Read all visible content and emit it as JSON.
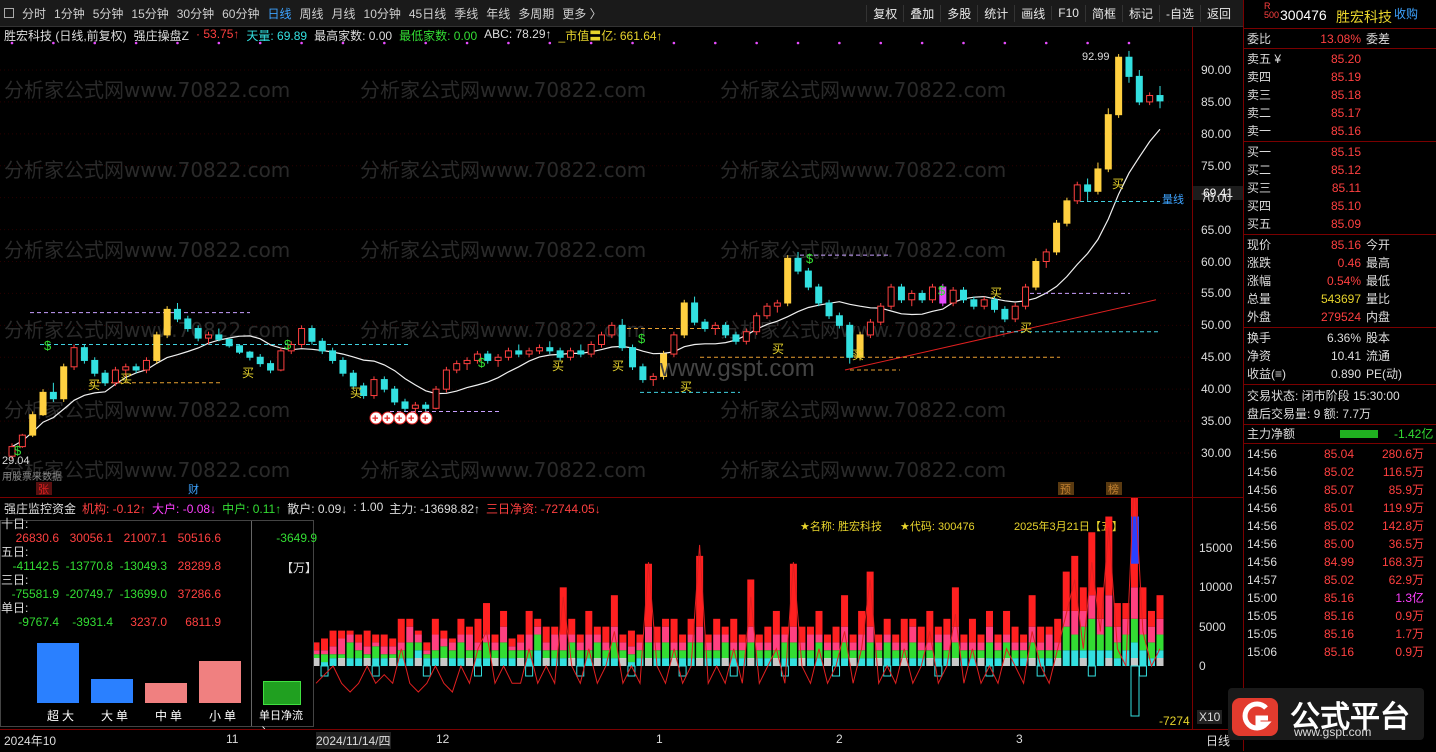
{
  "periods": [
    "分时",
    "1分钟",
    "5分钟",
    "15分钟",
    "30分钟",
    "60分钟",
    "日线",
    "周线",
    "月线",
    "10分钟",
    "45日线",
    "季线",
    "年线",
    "多周期",
    "更多 〉"
  ],
  "tools": [
    "复权",
    "叠加",
    "多股",
    "统计",
    "画线",
    "F10",
    "简框",
    "标记",
    "-自选",
    "返回"
  ],
  "main_header": [
    {
      "t": "胜宏科技 (日线,前复权)",
      "c": "w"
    },
    {
      "t": "强庄操盘Z",
      "c": "w"
    },
    {
      "t": "· 53.75↑",
      "c": "r"
    },
    {
      "t": "天量: 69.89",
      "c": "c1"
    },
    {
      "t": "最高家数: 0.00",
      "c": "w"
    },
    {
      "t": "最低家数: 0.00",
      "c": "g"
    },
    {
      "t": "ABC: 78.29↑",
      "c": "w"
    },
    {
      "t": "_市值〓亿: 661.64↑",
      "c": "y"
    }
  ],
  "price_axis": [
    "90.00",
    "85.00",
    "80.00",
    "75.00",
    "70.00",
    "65.00",
    "60.00",
    "55.00",
    "50.00",
    "45.00",
    "40.00",
    "35.00",
    "30.00"
  ],
  "price_box": "69.41",
  "annotations": {
    "high": "92.99",
    "low": "29.04",
    "liangxian": "量线",
    "watermark": "分析家公式网www.70822.com",
    "mark_zhang": "张",
    "mark_cai": "财",
    "mark_yu": "预",
    "mark_bang": "榜",
    "buy": "买",
    "dollar": "$",
    "gspt": "www.gspt.com",
    "bottom_note": "用股票来数据"
  },
  "lower_header": [
    {
      "t": "强庄监控资金",
      "c": "w"
    },
    {
      "t": "机构: -0.12↑",
      "c": "r"
    },
    {
      "t": "大户: -0.08↓",
      "c": "m"
    },
    {
      "t": "中户: 0.11↑",
      "c": "g"
    },
    {
      "t": "散户: 0.09↓",
      "c": "w"
    },
    {
      "t": ": 1.00",
      "c": "w"
    },
    {
      "t": "主力: -13698.82↑",
      "c": "w"
    },
    {
      "t": "三日净资: -72744.05↓",
      "c": "r"
    }
  ],
  "flow_table": {
    "rows": [
      {
        "label": "十日:",
        "vals": [
          "26830.6",
          "30056.1",
          "21007.1",
          "50516.6"
        ],
        "net": "-3649.9"
      },
      {
        "label": "五日:",
        "vals": [
          "-41142.5",
          "-13770.8",
          "-13049.3",
          "28289.8"
        ],
        "net": "【万】"
      },
      {
        "label": "三日:",
        "vals": [
          "-75581.9",
          "-20749.7",
          "-13699.0",
          "37286.6"
        ],
        "net": ""
      },
      {
        "label": "单日:",
        "vals": [
          "-9767.4",
          "-3931.4",
          "3237.0",
          "6811.9"
        ],
        "net": ""
      }
    ],
    "bar_labels": [
      "超大",
      "大单",
      "中单",
      "小单"
    ],
    "bar_values": [
      -9767.4,
      -3931.4,
      3237.0,
      6811.9
    ],
    "net_label": "单日净流入"
  },
  "lower_info": {
    "name": "★名称: 胜宏科技",
    "code": "★代码: 300476",
    "date": "2025年3月21日【五】"
  },
  "lower_axis": [
    "15000",
    "10000",
    "5000",
    "0"
  ],
  "lower_tag": "-7274",
  "x10": "X10",
  "xaxis": [
    "2024年10",
    "11",
    "2024/11/14/四",
    "12",
    "1",
    "2",
    "3",
    "日线"
  ],
  "right": {
    "stock_code": "300476",
    "stock_name": "胜宏科技",
    "fav": "收购",
    "webi": {
      "label": "委比",
      "value": "13.08%",
      "label2": "委差"
    },
    "asks": [
      {
        "l": "卖五 ¥",
        "v": "85.20"
      },
      {
        "l": "卖四",
        "v": "85.19"
      },
      {
        "l": "卖三",
        "v": "85.18"
      },
      {
        "l": "卖二",
        "v": "85.17"
      },
      {
        "l": "卖一",
        "v": "85.16"
      }
    ],
    "bids": [
      {
        "l": "买一",
        "v": "85.15"
      },
      {
        "l": "买二",
        "v": "85.12"
      },
      {
        "l": "买三",
        "v": "85.11"
      },
      {
        "l": "买四",
        "v": "85.10"
      },
      {
        "l": "买五",
        "v": "85.09"
      }
    ],
    "stats": [
      {
        "l": "现价",
        "v": "85.16",
        "l2": "今开",
        "c": "r"
      },
      {
        "l": "涨跌",
        "v": "0.46",
        "l2": "最高",
        "c": "r"
      },
      {
        "l": "涨幅",
        "v": "0.54%",
        "l2": "最低",
        "c": "r"
      },
      {
        "l": "总量",
        "v": "543697",
        "l2": "量比",
        "c": "y"
      },
      {
        "l": "外盘",
        "v": "279524",
        "l2": "内盘",
        "c": "r"
      }
    ],
    "stats2": [
      {
        "l": "换手",
        "v": "6.36%",
        "l2": "股本",
        "c": "w"
      },
      {
        "l": "净资",
        "v": "10.41",
        "l2": "流通",
        "c": "w"
      },
      {
        "l": "收益(≡)",
        "v": "0.890",
        "l2": "PE(动)",
        "c": "w"
      }
    ],
    "trade_state": "交易状态: 闭市阶段 15:30:00",
    "after_hours": "盘后交易量: 9  额: 7.7万",
    "main_net": {
      "label": "主力净额",
      "value": "-1.42亿"
    },
    "ticks": [
      {
        "t": "14:56",
        "p": "85.04",
        "v": "280.6万",
        "c": "r"
      },
      {
        "t": "14:56",
        "p": "85.02",
        "v": "116.5万",
        "c": "r"
      },
      {
        "t": "14:56",
        "p": "85.07",
        "v": "85.9万",
        "c": "r"
      },
      {
        "t": "14:56",
        "p": "85.01",
        "v": "119.9万",
        "c": "r"
      },
      {
        "t": "14:56",
        "p": "85.02",
        "v": "142.8万",
        "c": "r"
      },
      {
        "t": "14:56",
        "p": "85.00",
        "v": "36.5万",
        "c": "r"
      },
      {
        "t": "14:56",
        "p": "84.99",
        "v": "168.3万",
        "c": "r"
      },
      {
        "t": "14:57",
        "p": "85.02",
        "v": "62.9万",
        "c": "r"
      },
      {
        "t": "15:00",
        "p": "85.16",
        "v": "1.3亿",
        "c": "m"
      },
      {
        "t": "15:05",
        "p": "85.16",
        "v": "0.9万",
        "c": "r"
      },
      {
        "t": "15:05",
        "p": "85.16",
        "v": "1.7万",
        "c": "r"
      },
      {
        "t": "15:06",
        "p": "85.16",
        "v": "0.9万",
        "c": "r"
      }
    ]
  },
  "logo": {
    "text": "公式平台",
    "url": "www.gspt.com"
  },
  "candles": [
    [
      29.5,
      31.5,
      29.0,
      31.0
    ],
    [
      31.0,
      33.0,
      30.8,
      32.8
    ],
    [
      32.8,
      36.5,
      32.5,
      36.0
    ],
    [
      36.0,
      40.0,
      35.8,
      39.5
    ],
    [
      39.5,
      41.0,
      38.0,
      38.5
    ],
    [
      38.5,
      44.0,
      38.0,
      43.5
    ],
    [
      43.5,
      47.0,
      43.0,
      46.5
    ],
    [
      46.5,
      47.0,
      44.0,
      44.5
    ],
    [
      44.5,
      45.0,
      42.0,
      42.5
    ],
    [
      42.5,
      43.0,
      40.5,
      41.0
    ],
    [
      41.0,
      43.5,
      40.5,
      43.0
    ],
    [
      43.0,
      44.0,
      42.0,
      43.5
    ],
    [
      43.5,
      44.0,
      42.5,
      43.0
    ],
    [
      43.0,
      45.0,
      42.5,
      44.5
    ],
    [
      44.5,
      49.0,
      44.0,
      48.5
    ],
    [
      48.5,
      53.0,
      48.0,
      52.5
    ],
    [
      52.5,
      53.5,
      50.5,
      51.0
    ],
    [
      51.0,
      51.5,
      49.0,
      49.5
    ],
    [
      49.5,
      50.0,
      47.5,
      48.0
    ],
    [
      48.0,
      49.0,
      47.0,
      48.5
    ],
    [
      48.5,
      49.5,
      47.5,
      47.8
    ],
    [
      47.8,
      48.0,
      46.5,
      46.8
    ],
    [
      46.8,
      47.0,
      45.5,
      45.8
    ],
    [
      45.8,
      46.0,
      44.5,
      45.0
    ],
    [
      45.0,
      45.5,
      43.5,
      44.0
    ],
    [
      44.0,
      44.5,
      42.5,
      43.0
    ],
    [
      43.0,
      46.5,
      42.8,
      46.0
    ],
    [
      46.0,
      47.5,
      45.5,
      47.0
    ],
    [
      47.0,
      50.0,
      46.5,
      49.5
    ],
    [
      49.5,
      50.0,
      47.0,
      47.5
    ],
    [
      47.5,
      48.0,
      45.5,
      46.0
    ],
    [
      46.0,
      46.5,
      44.0,
      44.5
    ],
    [
      44.5,
      45.0,
      42.0,
      42.5
    ],
    [
      42.5,
      43.0,
      40.0,
      40.5
    ],
    [
      40.5,
      41.0,
      38.5,
      39.0
    ],
    [
      39.0,
      42.0,
      38.5,
      41.5
    ],
    [
      41.5,
      42.0,
      39.5,
      40.0
    ],
    [
      40.0,
      40.5,
      37.5,
      38.0
    ],
    [
      38.0,
      38.5,
      36.5,
      37.0
    ],
    [
      37.0,
      38.0,
      36.0,
      37.5
    ],
    [
      37.5,
      38.0,
      36.5,
      37.0
    ],
    [
      37.0,
      40.5,
      36.8,
      40.0
    ],
    [
      40.0,
      43.5,
      39.5,
      43.0
    ],
    [
      43.0,
      44.5,
      42.5,
      44.0
    ],
    [
      44.0,
      45.0,
      43.0,
      44.5
    ],
    [
      44.5,
      46.0,
      44.0,
      45.5
    ],
    [
      45.5,
      46.0,
      44.0,
      44.5
    ],
    [
      44.5,
      45.5,
      43.5,
      45.0
    ],
    [
      45.0,
      46.5,
      44.5,
      46.0
    ],
    [
      46.0,
      47.0,
      45.0,
      45.5
    ],
    [
      45.5,
      46.5,
      45.0,
      46.0
    ],
    [
      46.0,
      47.0,
      45.5,
      46.5
    ],
    [
      46.5,
      47.5,
      45.5,
      46.0
    ],
    [
      46.0,
      46.5,
      44.5,
      45.0
    ],
    [
      45.0,
      46.5,
      44.5,
      46.0
    ],
    [
      46.0,
      47.0,
      45.0,
      45.5
    ],
    [
      45.5,
      47.5,
      45.0,
      47.0
    ],
    [
      47.0,
      49.0,
      46.5,
      48.5
    ],
    [
      48.5,
      50.5,
      48.0,
      50.0
    ],
    [
      50.0,
      51.0,
      46.0,
      46.5
    ],
    [
      46.5,
      47.0,
      43.0,
      43.5
    ],
    [
      43.5,
      44.0,
      41.0,
      41.5
    ],
    [
      41.5,
      42.5,
      40.5,
      42.0
    ],
    [
      42.0,
      46.0,
      41.5,
      45.5
    ],
    [
      45.5,
      49.0,
      45.0,
      48.5
    ],
    [
      48.5,
      54.0,
      48.0,
      53.5
    ],
    [
      53.5,
      54.5,
      50.0,
      50.5
    ],
    [
      50.5,
      51.0,
      49.0,
      49.5
    ],
    [
      49.5,
      50.5,
      48.5,
      50.0
    ],
    [
      50.0,
      50.5,
      48.0,
      48.5
    ],
    [
      48.5,
      49.0,
      47.0,
      47.5
    ],
    [
      47.5,
      49.5,
      47.0,
      49.0
    ],
    [
      49.0,
      52.0,
      48.5,
      51.5
    ],
    [
      51.5,
      53.5,
      51.0,
      53.0
    ],
    [
      53.0,
      54.0,
      52.0,
      53.5
    ],
    [
      53.5,
      61.0,
      53.0,
      60.5
    ],
    [
      60.5,
      61.5,
      58.0,
      58.5
    ],
    [
      58.5,
      59.0,
      55.5,
      56.0
    ],
    [
      56.0,
      56.5,
      53.0,
      53.5
    ],
    [
      53.5,
      54.0,
      51.0,
      51.5
    ],
    [
      51.5,
      52.0,
      49.5,
      50.0
    ],
    [
      50.0,
      50.5,
      44.0,
      45.0
    ],
    [
      45.0,
      49.0,
      44.5,
      48.5
    ],
    [
      48.5,
      51.0,
      48.0,
      50.5
    ],
    [
      50.5,
      53.5,
      50.0,
      53.0
    ],
    [
      53.0,
      56.5,
      52.5,
      56.0
    ],
    [
      56.0,
      56.5,
      53.5,
      54.0
    ],
    [
      54.0,
      55.5,
      53.0,
      55.0
    ],
    [
      55.0,
      55.5,
      53.5,
      54.0
    ],
    [
      54.0,
      56.5,
      53.5,
      56.0
    ],
    [
      56.0,
      56.5,
      53.0,
      53.5
    ],
    [
      53.5,
      56.0,
      53.0,
      55.5
    ],
    [
      55.5,
      56.0,
      53.5,
      54.0
    ],
    [
      54.0,
      54.5,
      52.5,
      53.0
    ],
    [
      53.0,
      54.5,
      52.5,
      54.0
    ],
    [
      54.0,
      54.5,
      52.0,
      52.5
    ],
    [
      52.5,
      53.0,
      50.5,
      51.0
    ],
    [
      51.0,
      53.5,
      50.5,
      53.0
    ],
    [
      53.0,
      56.5,
      52.5,
      56.0
    ],
    [
      56.0,
      60.5,
      55.5,
      60.0
    ],
    [
      60.0,
      62.0,
      59.0,
      61.5
    ],
    [
      61.5,
      66.5,
      61.0,
      66.0
    ],
    [
      66.0,
      70.0,
      65.5,
      69.5
    ],
    [
      69.5,
      72.5,
      69.0,
      72.0
    ],
    [
      72.0,
      73.0,
      69.5,
      71.0
    ],
    [
      71.0,
      75.5,
      70.5,
      74.5
    ],
    [
      74.5,
      84.0,
      74.0,
      83.0
    ],
    [
      83.0,
      92.5,
      82.5,
      92.0
    ],
    [
      92.0,
      92.99,
      88.0,
      89.0
    ],
    [
      89.0,
      90.0,
      84.5,
      85.0
    ],
    [
      85.0,
      86.5,
      84.5,
      86.0
    ],
    [
      86.0,
      87.5,
      84.0,
      85.16
    ]
  ],
  "flow_bars": [
    [
      1,
      0.5,
      0.5,
      1
    ],
    [
      1.5,
      0.5,
      1,
      0.5
    ],
    [
      2,
      1,
      0.5,
      1
    ],
    [
      1,
      2,
      1,
      0.5
    ],
    [
      0.5,
      1,
      2,
      1
    ],
    [
      1,
      1,
      1,
      1
    ],
    [
      2,
      1,
      1,
      0.5
    ],
    [
      1,
      0.5,
      1.5,
      1
    ],
    [
      1.5,
      1,
      0.5,
      1
    ],
    [
      1,
      1,
      1,
      0.5
    ],
    [
      3,
      1,
      1,
      1
    ],
    [
      1,
      2,
      2,
      1
    ],
    [
      0.5,
      1,
      1,
      2
    ],
    [
      1,
      0.5,
      0.5,
      1
    ],
    [
      2,
      2,
      1,
      1
    ],
    [
      1,
      1,
      2,
      0.5
    ],
    [
      0.5,
      1,
      1,
      1
    ],
    [
      2,
      1,
      2,
      1
    ],
    [
      1,
      2,
      1,
      1
    ],
    [
      3,
      1,
      1,
      1
    ],
    [
      4,
      1,
      2,
      1
    ],
    [
      1,
      1,
      1,
      1
    ],
    [
      2,
      2,
      2,
      1
    ],
    [
      1,
      0.5,
      1,
      1
    ],
    [
      1,
      1,
      1,
      1
    ],
    [
      3,
      2,
      1,
      1
    ],
    [
      1,
      1,
      2,
      2
    ],
    [
      2,
      1,
      1,
      1
    ],
    [
      1,
      2,
      1,
      1
    ],
    [
      6,
      2,
      1,
      1
    ],
    [
      2,
      1,
      2,
      1
    ],
    [
      1,
      1,
      1,
      1
    ],
    [
      3,
      2,
      1,
      1
    ],
    [
      1,
      1,
      2,
      1
    ],
    [
      2,
      1,
      1,
      1
    ],
    [
      4,
      2,
      2,
      1
    ],
    [
      1,
      1,
      1,
      1
    ],
    [
      2,
      1,
      1,
      0.5
    ],
    [
      1,
      1,
      1,
      1
    ],
    [
      8,
      2,
      2,
      1
    ],
    [
      2,
      1,
      1,
      1
    ],
    [
      1,
      2,
      2,
      1
    ],
    [
      3,
      1,
      1,
      1
    ],
    [
      1,
      1,
      1,
      1
    ],
    [
      2,
      1,
      2,
      1
    ],
    [
      9,
      2,
      2,
      1
    ],
    [
      1,
      1,
      1,
      1
    ],
    [
      2,
      2,
      1,
      1
    ],
    [
      1,
      1,
      2,
      1
    ],
    [
      3,
      1,
      1,
      1
    ],
    [
      1,
      1,
      1,
      1
    ],
    [
      6,
      2,
      2,
      1
    ],
    [
      1,
      1,
      1,
      1
    ],
    [
      2,
      1,
      1,
      1
    ],
    [
      3,
      2,
      1,
      1
    ],
    [
      1,
      1,
      2,
      1
    ],
    [
      8,
      2,
      2,
      1
    ],
    [
      2,
      1,
      1,
      1
    ],
    [
      1,
      2,
      1,
      1
    ],
    [
      3,
      1,
      2,
      1
    ],
    [
      1,
      1,
      1,
      1
    ],
    [
      2,
      1,
      1,
      1
    ],
    [
      4,
      2,
      2,
      1
    ],
    [
      1,
      1,
      1,
      1
    ],
    [
      3,
      2,
      1,
      1
    ],
    [
      7,
      2,
      2,
      1
    ],
    [
      1,
      1,
      1,
      1
    ],
    [
      2,
      1,
      2,
      1
    ],
    [
      1,
      1,
      1,
      1
    ],
    [
      3,
      1,
      1,
      1
    ],
    [
      1,
      2,
      2,
      1
    ],
    [
      2,
      1,
      1,
      1
    ],
    [
      4,
      1,
      1,
      1
    ],
    [
      1,
      1,
      2,
      1
    ],
    [
      2,
      2,
      1,
      1
    ],
    [
      5,
      2,
      2,
      1
    ],
    [
      1,
      1,
      1,
      1
    ],
    [
      3,
      1,
      1,
      1
    ],
    [
      1,
      1,
      1,
      1
    ],
    [
      2,
      2,
      2,
      1
    ],
    [
      1,
      1,
      1,
      1
    ],
    [
      3,
      1,
      2,
      1
    ],
    [
      2,
      1,
      1,
      1
    ],
    [
      1,
      1,
      1,
      1
    ],
    [
      4,
      2,
      2,
      1
    ],
    [
      2,
      1,
      1,
      1
    ],
    [
      1,
      2,
      1,
      1
    ],
    [
      3,
      1,
      1,
      1
    ],
    [
      5,
      2,
      3,
      2
    ],
    [
      7,
      3,
      2,
      2
    ],
    [
      3,
      2,
      3,
      2
    ],
    [
      8,
      3,
      4,
      2
    ],
    [
      4,
      2,
      2,
      2
    ],
    [
      10,
      4,
      3,
      2
    ],
    [
      3,
      2,
      2,
      1
    ],
    [
      2,
      2,
      2,
      2
    ],
    [
      13,
      4,
      3,
      3
    ],
    [
      4,
      2,
      2,
      2
    ],
    [
      2,
      2,
      2,
      1
    ],
    [
      3,
      2,
      2,
      2
    ]
  ]
}
